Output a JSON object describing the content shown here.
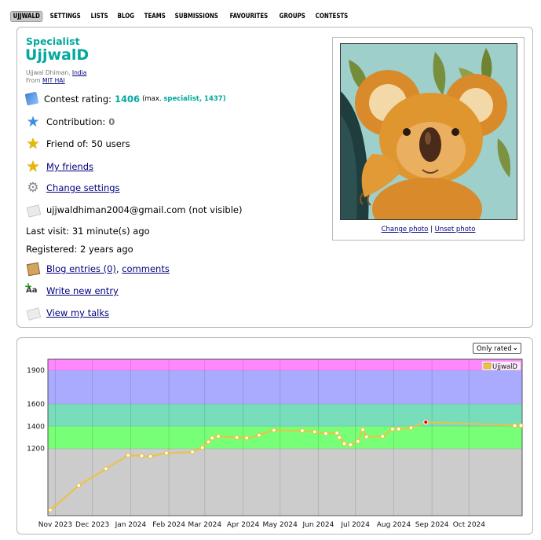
{
  "nav": {
    "items": [
      "UJJWALD",
      "SETTINGS",
      "LISTS",
      "BLOG",
      "TEAMS",
      "SUBMISSIONS",
      "FAVOURITES",
      "GROUPS",
      "CONTESTS"
    ],
    "active_index": 0
  },
  "profile": {
    "rank": "Specialist",
    "handle": "UjjwalD",
    "full_name": "Ujjwal Dhiman,",
    "country": "India",
    "from_label": "From",
    "organization": "MIT HAI",
    "rating_label": "Contest rating:",
    "rating_value": "1406",
    "rating_max_prefix": "(max.",
    "rating_max_rank": "specialist, 1437)",
    "contribution_label": "Contribution:",
    "contribution_value": "0",
    "friend_of": "Friend of: 50 users",
    "my_friends": "My friends",
    "change_settings": "Change settings",
    "email": "ujjwaldhiman2004@gmail.com (not visible)",
    "last_visit": "Last visit: 31 minute(s) ago",
    "registered": "Registered: 2 years ago",
    "blog_entries": "Blog entries (0)",
    "comma": ",",
    "comments": "comments",
    "write_new_entry": "Write new entry",
    "view_my_talks": "View my talks",
    "change_photo": "Change photo",
    "photo_separator": "|",
    "unset_photo": "Unset photo"
  },
  "graph": {
    "filter_value": "Only rated"
  },
  "colors": {
    "specialist": "#03a89e",
    "link": "#00007f"
  },
  "icons": [
    "rating-icon",
    "contribution-star-icon",
    "friend-star-icon",
    "friends-star-icon",
    "gear-icon",
    "mail-icon",
    "blog-icon",
    "write-entry-icon",
    "talks-icon"
  ],
  "chart_data": {
    "type": "line",
    "x_ticks": [
      "Nov 2023",
      "Dec 2023",
      "Jan 2024",
      "Feb 2024",
      "Mar 2024",
      "Apr 2024",
      "May 2024",
      "Jun 2024",
      "Jul 2024",
      "Aug 2024",
      "Sep 2024",
      "Oct 2024"
    ],
    "y_ticks": [
      1200,
      1400,
      1600,
      1900
    ],
    "ylim": [
      600,
      2000
    ],
    "rank_bands": [
      {
        "from": 600,
        "to": 1200,
        "color": "#cccccc"
      },
      {
        "from": 1200,
        "to": 1400,
        "color": "#77ff77"
      },
      {
        "from": 1400,
        "to": 1600,
        "color": "#77ddbb"
      },
      {
        "from": 1600,
        "to": 1900,
        "color": "#aaaaff"
      },
      {
        "from": 1900,
        "to": 2000,
        "color": "#ff88ff"
      }
    ],
    "series": [
      {
        "name": "UjjwalD",
        "color": "#edc240",
        "points": [
          [
            "2023-10-28",
            650
          ],
          [
            "2023-11-20",
            870
          ],
          [
            "2023-12-12",
            1020
          ],
          [
            "2023-12-30",
            1140
          ],
          [
            "2024-01-10",
            1135
          ],
          [
            "2024-01-17",
            1130
          ],
          [
            "2024-01-30",
            1160
          ],
          [
            "2024-02-20",
            1170
          ],
          [
            "2024-02-28",
            1210
          ],
          [
            "2024-03-04",
            1260
          ],
          [
            "2024-03-07",
            1295
          ],
          [
            "2024-03-12",
            1310
          ],
          [
            "2024-03-27",
            1300
          ],
          [
            "2024-04-04",
            1295
          ],
          [
            "2024-04-14",
            1320
          ],
          [
            "2024-04-26",
            1365
          ],
          [
            "2024-05-19",
            1360
          ],
          [
            "2024-05-29",
            1350
          ],
          [
            "2024-06-07",
            1335
          ],
          [
            "2024-06-16",
            1340
          ],
          [
            "2024-06-18",
            1300
          ],
          [
            "2024-06-22",
            1245
          ],
          [
            "2024-06-27",
            1235
          ],
          [
            "2024-07-03",
            1265
          ],
          [
            "2024-07-07",
            1370
          ],
          [
            "2024-07-10",
            1305
          ],
          [
            "2024-07-23",
            1310
          ],
          [
            "2024-07-31",
            1375
          ],
          [
            "2024-08-05",
            1375
          ],
          [
            "2024-08-15",
            1385
          ],
          [
            "2024-08-27",
            1437
          ],
          [
            "2024-11-07",
            1406
          ],
          [
            "2024-11-12",
            1406
          ]
        ],
        "highlight": [
          "2024-08-27",
          1437
        ]
      }
    ]
  }
}
